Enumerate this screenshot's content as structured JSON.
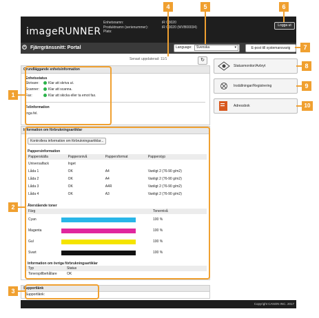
{
  "header": {
    "logo": "imageRUNNER",
    "labels": [
      "Enhetsnamn:",
      "Produktnamn (serienummer):",
      "Plats:"
    ],
    "values": [
      "iR C3020",
      "iR C3020 (WVB00034)",
      ""
    ],
    "logout": "Logga ut",
    "portal_title": "Fjärrgränssnitt: Portal",
    "language_label": "Language:",
    "language_value": "Svenska",
    "email_button": "E-post till systemansvarig"
  },
  "updated": "Senast uppdaterad: 11/1",
  "basic": {
    "title": "Grundläggande enhetsinformation",
    "status_title": "Enhetsstatus",
    "rows": [
      {
        "label": "Skrivare:",
        "value": "Klar att skriva ut."
      },
      {
        "label": "Scanner:",
        "value": "Klar att scanna."
      },
      {
        "label": "Fax:",
        "value": "Klar att skicka eller ta emot fax."
      }
    ],
    "error_title": "Felinformation",
    "error_value": "Inga fel."
  },
  "consumables": {
    "title": "Information om förbrukningsartiklar",
    "check_button": "Kontrollera information om förbrukningsartiklar...",
    "paper_title": "Pappersinformation",
    "paper_headers": [
      "Papperskälla",
      "Pappersnivå",
      "Pappersformat",
      "Papperstyp"
    ],
    "paper_rows": [
      [
        "Universalfack",
        "Inget",
        "",
        ""
      ],
      [
        "Låda 1",
        "OK",
        "A4",
        "Vanligt 2 (76-90 g/m2)"
      ],
      [
        "Låda 2",
        "OK",
        "A4",
        "Vanligt 2 (76-90 g/m2)"
      ],
      [
        "Låda 3",
        "OK",
        "A4R",
        "Vanligt 2 (76-90 g/m2)"
      ],
      [
        "Låda 4",
        "OK",
        "A3",
        "Vanligt 2 (76-90 g/m2)"
      ]
    ],
    "toner_title": "Återstående toner",
    "toner_headers": [
      "Färg",
      "Tonernivå"
    ],
    "toners": [
      {
        "name": "Cyan",
        "level": "100 %",
        "color": "#29b6e8"
      },
      {
        "name": "Magenta",
        "level": "100 %",
        "color": "#e0289e"
      },
      {
        "name": "Gul",
        "level": "100 %",
        "color": "#f5e400"
      },
      {
        "name": "Svart",
        "level": "100 %",
        "color": "#111111"
      }
    ],
    "other_title": "Information om övriga förbrukningsartiklar",
    "other_headers": [
      "Typ",
      "Status"
    ],
    "other_row": [
      "Tonerspillbehållare",
      "OK"
    ]
  },
  "support": {
    "title": "Supportlänk",
    "label": "Supportlänk:"
  },
  "right_buttons": [
    {
      "label": "Statusmonitor/Avbryt",
      "icon": "status-monitor-icon"
    },
    {
      "label": "Inställningar/Registrering",
      "icon": "settings-icon"
    },
    {
      "label": "Adressbok",
      "icon": "address-book-icon"
    }
  ],
  "callouts": [
    "1",
    "2",
    "3",
    "4",
    "5",
    "6",
    "7",
    "8",
    "9",
    "10"
  ],
  "footer": "Copyright CANON INC. 2017"
}
